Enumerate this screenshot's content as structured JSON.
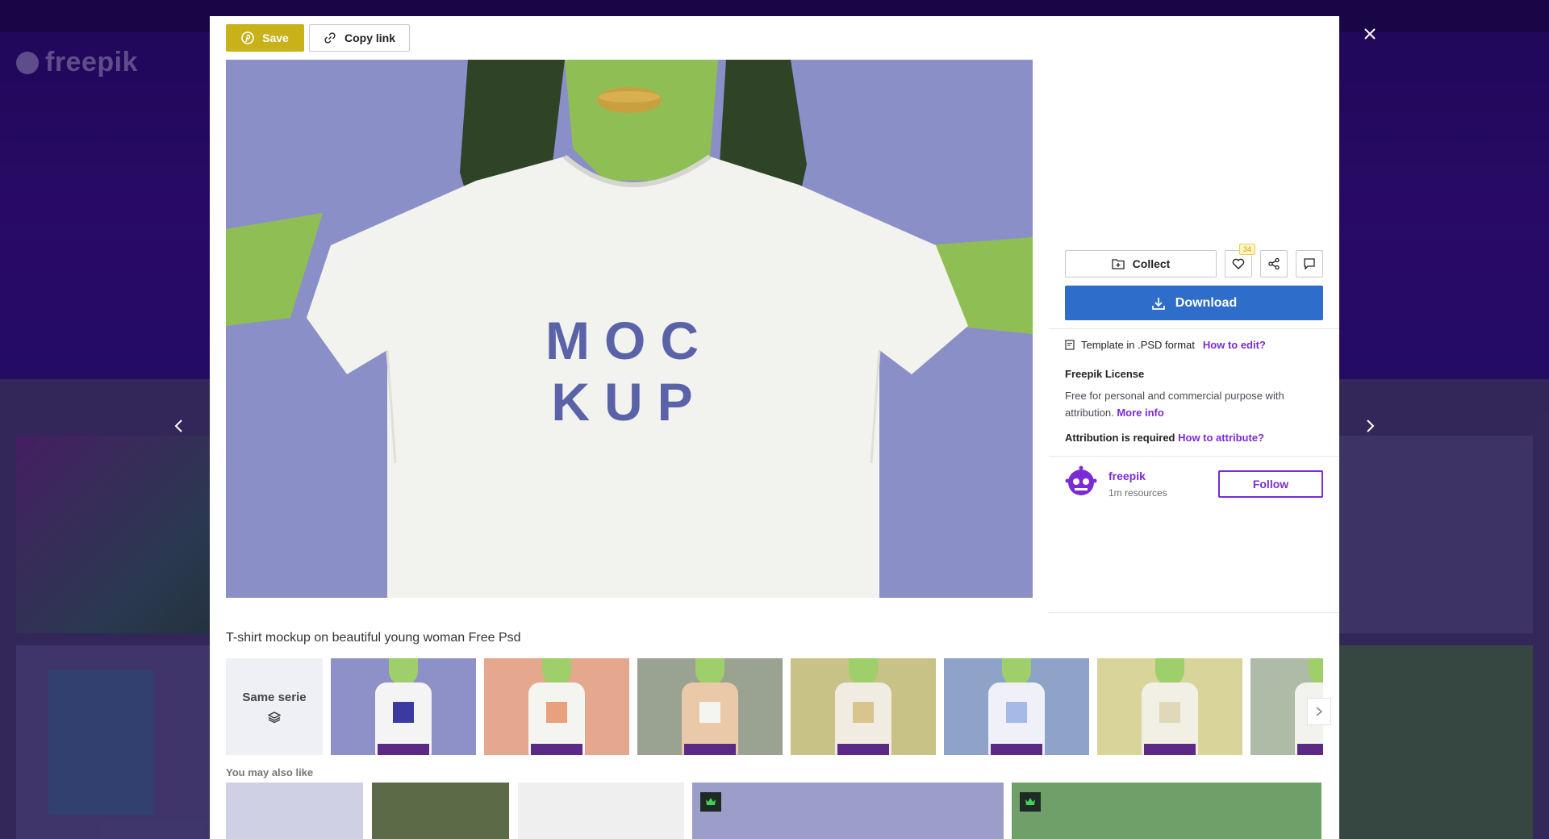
{
  "background": {
    "logo_text": "freepik"
  },
  "toolbar": {
    "save_label": "Save",
    "copy_link_label": "Copy link"
  },
  "image": {
    "shirt_text_line1": "MOC",
    "shirt_text_line2": "KUP",
    "background_color": "#8a8fc8"
  },
  "actions": {
    "collect_label": "Collect",
    "like_count": "34",
    "download_label": "Download"
  },
  "details": {
    "format_text": "Template in .PSD format",
    "how_to_edit": "How to edit?",
    "license_title": "Freepik License",
    "license_text": "Free for personal and commercial purpose with attribution.",
    "more_info": "More info",
    "attribution_text": "Attribution is required",
    "how_to_attribute": "How to attribute?"
  },
  "author": {
    "name": "freepik",
    "resources": "1m resources",
    "follow_label": "Follow"
  },
  "resource_title": "T-shirt mockup on beautiful young woman Free Psd",
  "series": {
    "label": "Same serie",
    "thumbnails": [
      {
        "bg": "#8e90c8",
        "shirt": "#f4f4f4",
        "print": "#3a3aa0"
      },
      {
        "bg": "#e5a88e",
        "shirt": "#f4f4f0",
        "print": "#e9a07c"
      },
      {
        "bg": "#9aa292",
        "shirt": "#e9c9a8",
        "print": "#f4f4f0"
      },
      {
        "bg": "#c9c286",
        "shirt": "#f0ece2",
        "print": "#d8c48c"
      },
      {
        "bg": "#8fa3c8",
        "shirt": "#f0f0f8",
        "print": "#a7b9e8"
      },
      {
        "bg": "#d9d59a",
        "shirt": "#f2efe4",
        "print": "#e0d8b8"
      },
      {
        "bg": "#aebba6",
        "shirt": "#f2f2ee",
        "print": "#dfe6d8"
      }
    ]
  },
  "also_like": {
    "label": "You may also like",
    "items": [
      {
        "bg": "#cfd0e4",
        "premium": false
      },
      {
        "bg": "#5c6a48",
        "premium": false
      },
      {
        "bg": "#efefef",
        "premium": false
      },
      {
        "bg": "#9a9ec8",
        "premium": true
      },
      {
        "bg": "#6fa06a",
        "premium": true
      }
    ]
  },
  "colors": {
    "save": "#c9b11a",
    "download": "#2f6dca",
    "accent": "#7b2bd4"
  }
}
